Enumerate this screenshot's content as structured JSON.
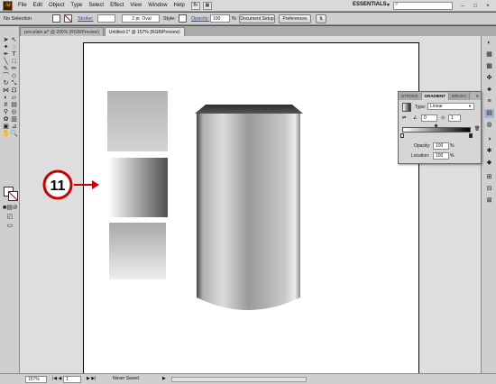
{
  "app": {
    "icon_text": "Ai",
    "menu": [
      "File",
      "Edit",
      "Object",
      "Type",
      "Select",
      "Effect",
      "View",
      "Window",
      "Help"
    ],
    "workspace": "ESSENTIALS",
    "win_controls": [
      "–",
      "□",
      "×"
    ]
  },
  "control_bar": {
    "selection": "No Selection",
    "stroke_label": "Stroke:",
    "brush_value": "2 pt. Oval",
    "style_label": "Style:",
    "opacity_label": "Opacity:",
    "opacity_value": "100",
    "opacity_unit": "%",
    "document_setup": "Document Setup",
    "preferences": "Preferences"
  },
  "tabs": [
    {
      "label": "porcelain.ai* @ 200% (RGB/Preview)",
      "active": false
    },
    {
      "label": "Untitled-1* @ 157% (RGB/Preview)",
      "active": true
    }
  ],
  "status_bar": {
    "zoom": "157%",
    "page": "1",
    "status": "Never Saved"
  },
  "panel": {
    "tabs": [
      "STROKE",
      "GRADIENT",
      "BRUSH"
    ],
    "type_label": "Type:",
    "type_value": "Linear",
    "angle_value": "0",
    "aspect_value": "1",
    "opacity_label": "Opacity:",
    "opacity_value": "100",
    "location_label": "Location:",
    "location_value": "100",
    "unit": "%"
  },
  "annotation": {
    "number": "11"
  },
  "colors": {
    "menu_bg": "#d9d9d9",
    "canvas_bg": "#dedede",
    "annotation_red": "#cc0000"
  }
}
